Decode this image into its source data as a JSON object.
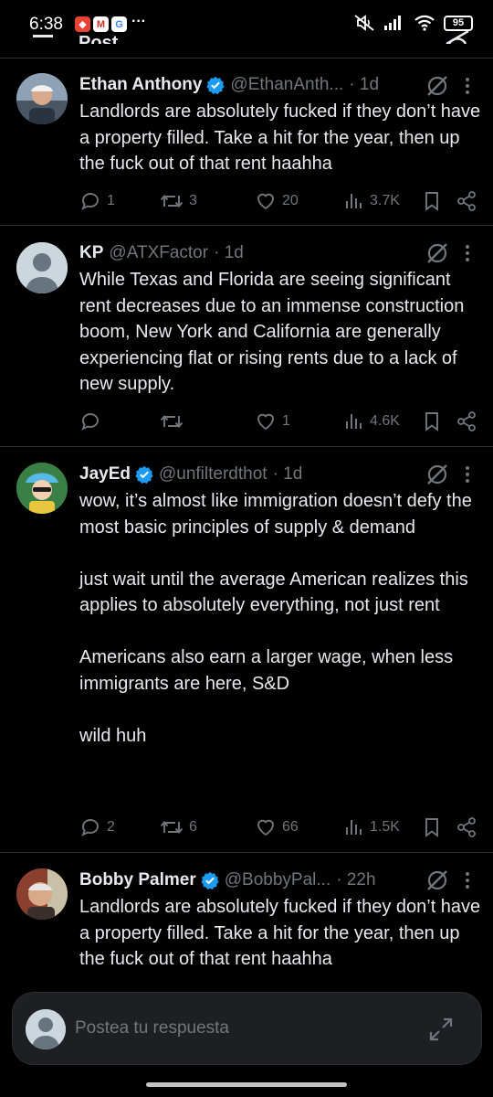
{
  "status_bar": {
    "time": "6:38",
    "notif_icons": [
      "shopee-icon",
      "gmail-icon",
      "google-icon"
    ],
    "more": "···",
    "battery": "95"
  },
  "header": {
    "title": "Post"
  },
  "tweets": [
    {
      "name": "Ethan Anthony",
      "verified": true,
      "handle": "@EthanAnth...",
      "time": "· 1d",
      "text": "Landlords are absolutely fucked if they don’t have a property filled. Take a hit for the year, then up the fuck out of that rent haahha",
      "replies": "1",
      "reposts": "3",
      "likes": "20",
      "views": "3.7K"
    },
    {
      "name": "KP",
      "verified": false,
      "handle": "@ATXFactor",
      "time": "· 1d",
      "text": "While Texas and Florida are seeing significant rent decreases due to an immense construction boom, New York and California are generally experiencing flat or rising rents due to a lack of new supply.",
      "replies": "",
      "reposts": "",
      "likes": "1",
      "views": "4.6K"
    },
    {
      "name": "JayEd",
      "verified": true,
      "handle": "@unfilterdthot",
      "time": "· 1d",
      "text": "wow, it’s almost like immigration doesn’t defy the most basic principles of supply & demand\n\njust wait until the average American realizes this applies to absolutely everything, not just rent\n\nAmericans also earn a larger wage, when less immigrants are here, S&D\n\nwild huh",
      "replies": "2",
      "reposts": "6",
      "likes": "66",
      "views": "1.5K"
    },
    {
      "name": "Bobby Palmer",
      "verified": true,
      "handle": "@BobbyPal...",
      "time": "· 22h",
      "text": "Landlords are absolutely fucked if they don’t have a property filled. Take a hit for the year, then up the fuck out of that rent haahha",
      "replies": "",
      "reposts": "",
      "likes": "",
      "views": ""
    }
  ],
  "reply_bar": {
    "placeholder": "Postea tu respuesta"
  },
  "colors": {
    "background": "#000000",
    "text": "#e7e9ea",
    "muted": "#71767b",
    "verified": "#1d9bf0",
    "divider": "#2f3336"
  }
}
